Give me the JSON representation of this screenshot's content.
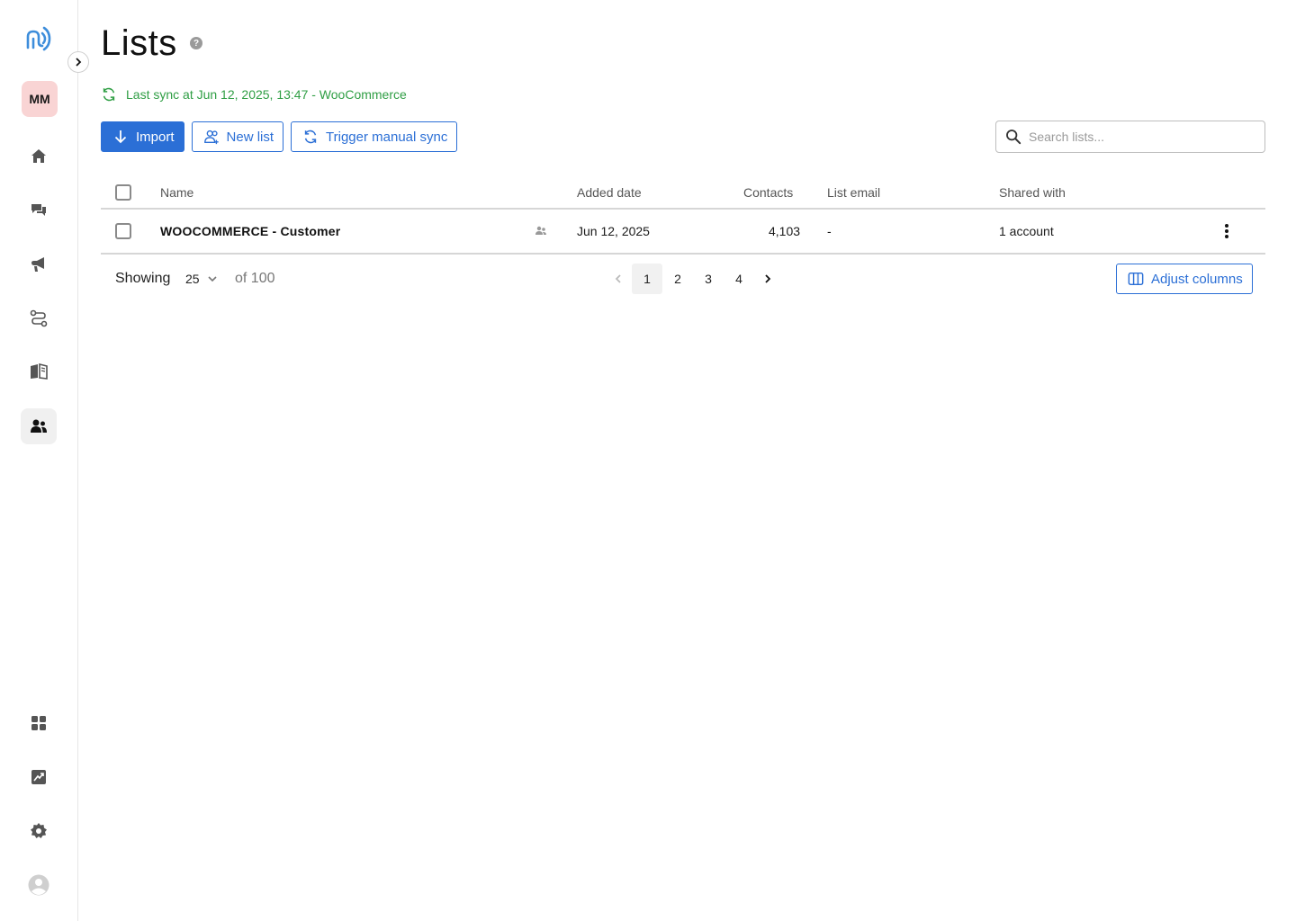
{
  "sidebar": {
    "avatar_initials": "MM",
    "items": [
      {
        "name": "home-icon"
      },
      {
        "name": "chat-icon"
      },
      {
        "name": "megaphone-icon"
      },
      {
        "name": "automation-icon"
      },
      {
        "name": "book-icon"
      },
      {
        "name": "contacts-icon",
        "active": true
      },
      {
        "name": "apps-icon"
      },
      {
        "name": "reports-icon"
      },
      {
        "name": "settings-icon"
      },
      {
        "name": "user-avatar-icon"
      }
    ]
  },
  "header": {
    "title": "Lists",
    "sync_text": "Last sync at Jun 12, 2025, 13:47 - WooCommerce"
  },
  "toolbar": {
    "import_label": "Import",
    "new_list_label": "New list",
    "sync_label": "Trigger manual sync"
  },
  "search": {
    "placeholder": "Search lists..."
  },
  "table": {
    "columns": {
      "name": "Name",
      "added_date": "Added date",
      "contacts": "Contacts",
      "list_email": "List email",
      "shared_with": "Shared with"
    },
    "rows": [
      {
        "name": "WOOCOMMERCE - Customer",
        "added_date": "Jun 12, 2025",
        "contacts": "4,103",
        "list_email": "-",
        "shared_with": "1 account"
      }
    ]
  },
  "footer": {
    "showing_label": "Showing",
    "per_page": "25",
    "of_total": "of 100",
    "pages": [
      "1",
      "2",
      "3",
      "4"
    ],
    "current_page": "1",
    "adjust_columns_label": "Adjust columns"
  },
  "colors": {
    "accent": "#2b6fd6",
    "sync_green": "#2f9e44",
    "avatar_bg": "#f9d4d4"
  }
}
